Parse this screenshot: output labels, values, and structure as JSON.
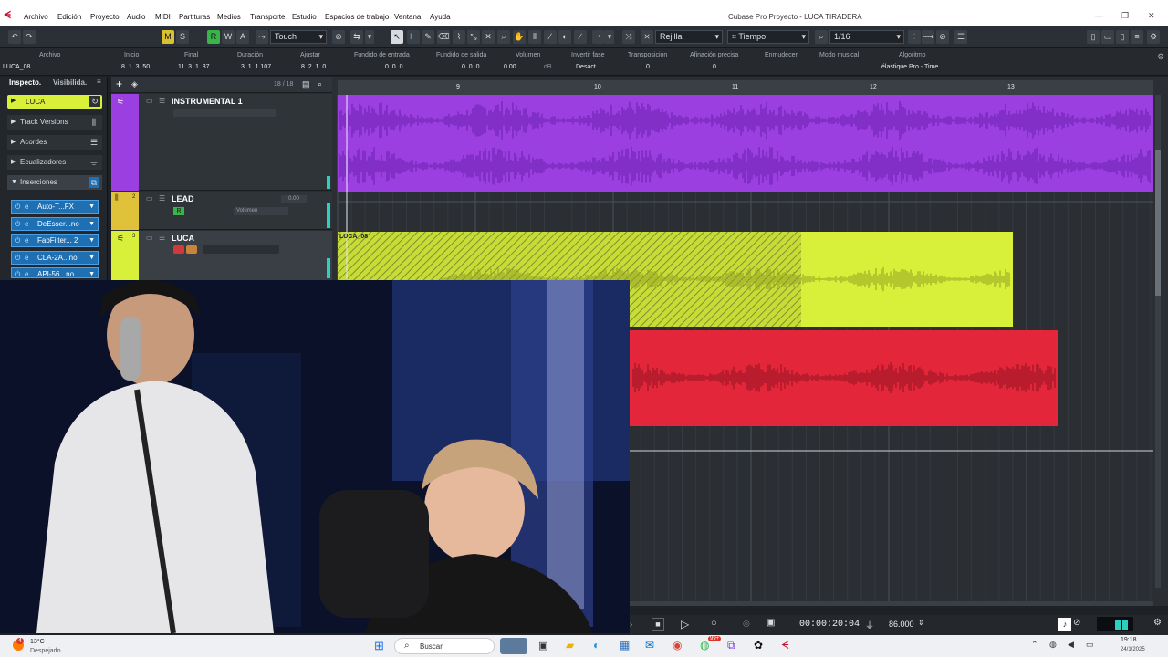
{
  "window": {
    "title": "Cubase Pro Proyecto - LUCA TIRADERA",
    "logo_glyph": "ᗕ"
  },
  "menu": [
    "Archivo",
    "Edición",
    "Proyecto",
    "Audio",
    "MIDI",
    "Partituras",
    "Medios",
    "Transporte",
    "Estudio",
    "Espacios de trabajo",
    "Ventana",
    "Ayuda"
  ],
  "toolbar": {
    "m_label": "M",
    "s_label": "S",
    "r_label": "R",
    "w_label": "W",
    "a_label": "A",
    "automation_mode": "Touch",
    "grid_type": "Rejilla",
    "time_format": "Tiempo",
    "quantize": "1/16"
  },
  "infoline": {
    "headers": [
      "Archivo",
      "Inicio",
      "Final",
      "Duración",
      "Ajustar",
      "Fundido de entrada",
      "Fundido de salida",
      "Volumen",
      "Invertir fase",
      "Transposición",
      "Afinación precisa",
      "Enmudecer",
      "Modo musical",
      "Algoritmo"
    ],
    "values": {
      "file": "LUCA_08",
      "start": "8. 1. 3. 50",
      "end": "11. 3. 1. 37",
      "length": "3. 1. 1.107",
      "snap": "8. 2. 1.   0",
      "fade_in": "0. 0. 0.",
      "fade_out": "0. 0. 0.",
      "volume": "0.00",
      "volume_unit": "dB",
      "invert_phase": "Desact.",
      "transpose": "0",
      "fine_tune": "0",
      "algorithm": "élastique Pro - Time"
    }
  },
  "inspector": {
    "tab_inspector": "Inspecto.",
    "tab_visibility": "Visibilida.",
    "track_name": "LUCA",
    "sections": [
      "Track Versions",
      "Acordes",
      "Ecualizadores",
      "Inserciones"
    ],
    "inserts": [
      "Auto-T...FX",
      "DeEsser...no",
      "FabFilter... 2",
      "CLA-2A...no",
      "API-56...no"
    ]
  },
  "tracklist": {
    "count": "18 / 18",
    "tracks": [
      {
        "num": "",
        "name": "INSTRUMENTAL 1",
        "color": "#9b3fe0"
      },
      {
        "num": "2",
        "name": "LEAD",
        "color": "#e0c23a",
        "value": "0.00",
        "param": "Volumen"
      },
      {
        "num": "3",
        "name": "LUCA",
        "color": "#d9f03a"
      }
    ]
  },
  "ruler": {
    "bars": [
      "9",
      "10",
      "11",
      "12",
      "13"
    ]
  },
  "events": {
    "luca_event_name": "LUCA_08"
  },
  "transport": {
    "time": "00:00:20:04",
    "tempo": "86.000"
  },
  "taskbar": {
    "temperature": "13°C",
    "weather": "Despejado",
    "search_placeholder": "Buscar",
    "clock": "19:18",
    "date": "24/1/2025",
    "notif_count": "99+",
    "weather_badge": "4"
  },
  "colors": {
    "purple": "#9b3fe0",
    "yellow": "#d9f03a",
    "red": "#e3263a",
    "accent_blue": "#1f6fb3"
  }
}
